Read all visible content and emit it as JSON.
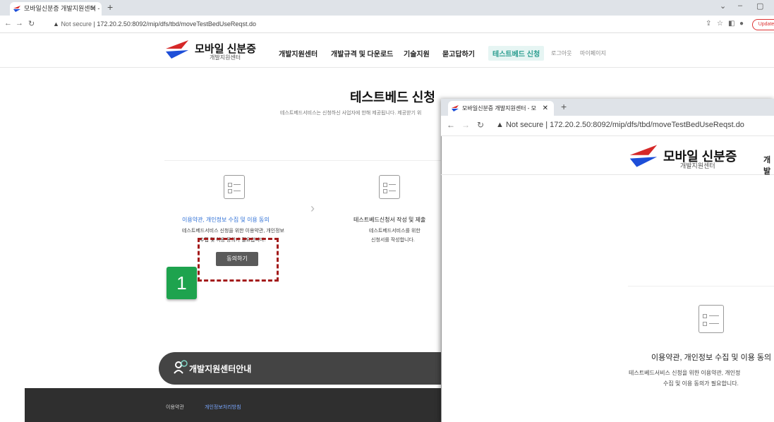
{
  "browser": {
    "tab_title": "모바일신분증 개발지원센터 - 모",
    "address_note": "Not secure",
    "url": "172.20.2.50:8092/mip/dfs/tbd/moveTestBedUseReqst.do",
    "update_label": "Update"
  },
  "site": {
    "brand": "모바일 신분증",
    "brand_sub": "개발지원센터",
    "menu": [
      "개발지원센터",
      "개발규격 및 다운로드",
      "기술지원",
      "묻고답하기",
      "테스트베드 신청",
      "로그아웃",
      "마이페이지"
    ]
  },
  "page": {
    "title": "테스트베드 신청",
    "subtitle": "테스트베드서비스는 신청하신 사업자에 한해 제공됩니다. 제공받기 위"
  },
  "steps": [
    {
      "title": "이용약관, 개인정보 수집 및 이용 동의",
      "desc1": "테스트베드서비스 신청을 위한 이용약관, 개인정보",
      "desc2": "수집 및 이용 동의가 필요합니다."
    },
    {
      "title": "테스트베드신청서 작성 및 제출",
      "desc1": "테스트베드서비스를 위한",
      "desc2": "신청서를 작성합니다."
    }
  ],
  "agree_button": "동의하기",
  "annotation_number": "1",
  "guide_label": "개발지원센터안내",
  "footer": {
    "terms": "이용약관",
    "privacy": "개인정보처리방침"
  },
  "overlay": {
    "tab_title": "모바일신분증 개발지원센터 - 모",
    "address_note": "Not secure",
    "url": "172.20.2.50:8092/mip/dfs/tbd/moveTestBedUseReqst.do",
    "brand": "모바일 신분증",
    "brand_sub": "개발지원센터",
    "menu_first": "개발",
    "step_title": "이용약관, 개인정보 수집 및 이용 동의",
    "step_desc1": "테스트베드서비스 신청을 위한 이용약관, 개인정",
    "step_desc2": "수집 및 이용 동의가 필요합니다."
  },
  "colors": {
    "active_menu": "#2a9d8f",
    "step_blue": "#2d6fd6",
    "annotation_green": "#1ea34e",
    "dash_red": "#a31b1b"
  }
}
